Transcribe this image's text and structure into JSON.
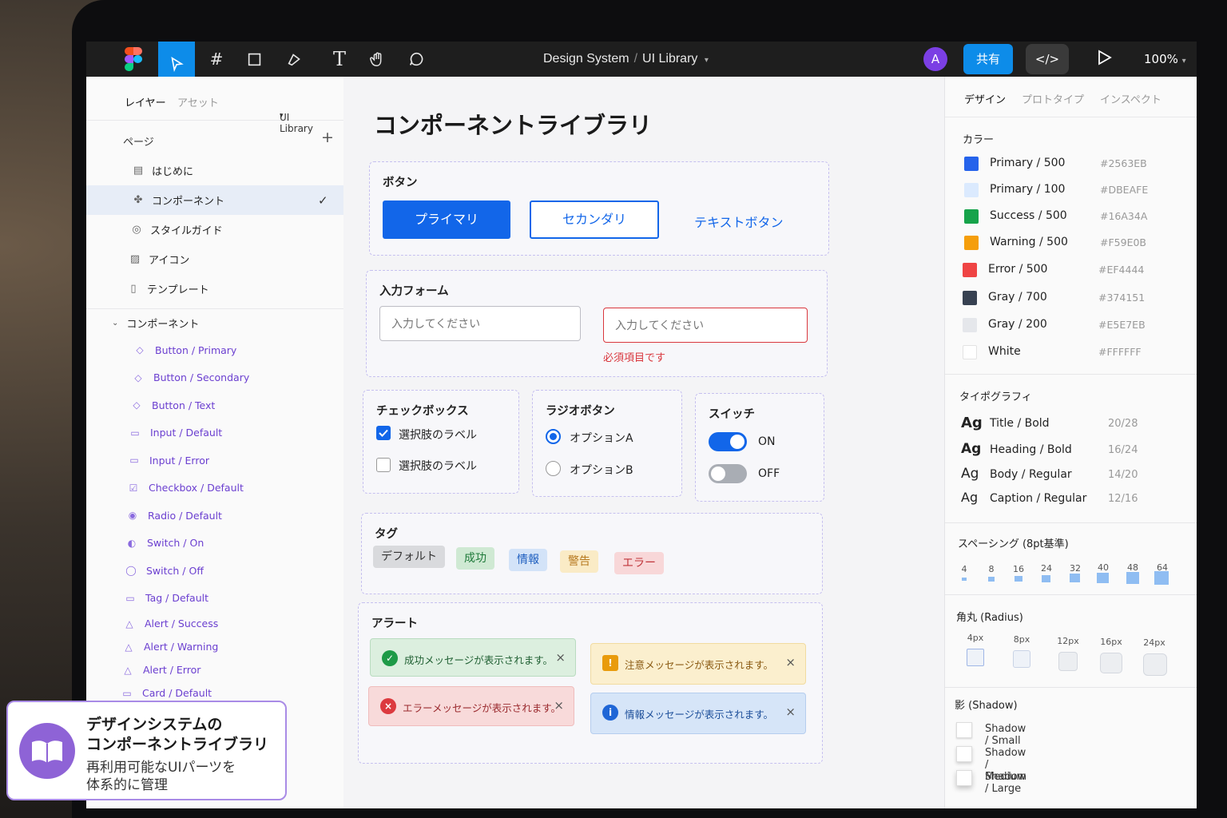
{
  "toolbar": {
    "breadcrumb_root": "Design System",
    "breadcrumb_sep": "/",
    "breadcrumb_current": "UI Library",
    "avatar_initial": "A",
    "share_label": "共有",
    "code_label": "</>",
    "zoom": "100%"
  },
  "left_panel": {
    "tab_layers": "レイヤー",
    "tab_assets": "アセット",
    "file_name": "UI Library",
    "pages_header": "ページ",
    "add_symbol": "+",
    "pages": [
      {
        "label": "はじめに"
      },
      {
        "label": "コンポーネント"
      },
      {
        "label": "スタイルガイド"
      },
      {
        "label": "アイコン"
      },
      {
        "label": "テンプレート"
      }
    ],
    "components_header": "コンポーネント",
    "components": [
      {
        "label": "Button / Primary"
      },
      {
        "label": "Button / Secondary"
      },
      {
        "label": "Button / Text"
      },
      {
        "label": "Input / Default"
      },
      {
        "label": "Input / Error"
      },
      {
        "label": "Checkbox / Default"
      },
      {
        "label": "Radio / Default"
      },
      {
        "label": "Switch / On"
      },
      {
        "label": "Switch / Off"
      },
      {
        "label": "Tag / Default"
      },
      {
        "label": "Alert / Success"
      },
      {
        "label": "Alert / Warning"
      },
      {
        "label": "Alert / Error"
      },
      {
        "label": "Card / Default"
      }
    ]
  },
  "canvas": {
    "page_title": "コンポーネントライブラリ",
    "buttons": {
      "label": "ボタン",
      "primary": "プライマリ",
      "secondary": "セカンダリ",
      "text": "テキストボタン"
    },
    "form": {
      "label": "入力フォーム",
      "placeholder": "入力してください",
      "error_placeholder": "入力してください",
      "error_message": "必須項目です"
    },
    "checkbox": {
      "label": "チェックボックス",
      "option1": "選択肢のラベル",
      "option1_checked": true,
      "option2": "選択肢のラベル",
      "option2_checked": false
    },
    "radio": {
      "label": "ラジオボタン",
      "optionA": "オプションA",
      "optionB": "オプションB",
      "selected": "A"
    },
    "switch": {
      "label": "スイッチ",
      "on_label": "ON",
      "off_label": "OFF"
    },
    "tags": {
      "label": "タグ",
      "items": [
        "デフォルト",
        "成功",
        "情報",
        "警告",
        "エラー"
      ]
    },
    "alerts": {
      "label": "アラート",
      "success": "成功メッセージが表示されます。",
      "warning": "注意メッセージが表示されます。",
      "error": "エラーメッセージが表示されます。",
      "info": "情報メッセージが表示されます。",
      "close": "×"
    }
  },
  "right_panel": {
    "tab_design": "デザイン",
    "tab_prototype": "プロトタイプ",
    "tab_inspect": "インスペクト",
    "colors_header": "カラー",
    "colors": [
      {
        "name": "Primary / 500",
        "hex": "#2563EB"
      },
      {
        "name": "Primary / 100",
        "hex": "#DBEAFE"
      },
      {
        "name": "Success / 500",
        "hex": "#16A34A"
      },
      {
        "name": "Warning / 500",
        "hex": "#F59E0B"
      },
      {
        "name": "Error / 500",
        "hex": "#EF4444"
      },
      {
        "name": "Gray / 700",
        "hex": "#374151"
      },
      {
        "name": "Gray / 200",
        "hex": "#E5E7EB"
      },
      {
        "name": "White",
        "hex": "#FFFFFF"
      }
    ],
    "typography_header": "タイポグラフィ",
    "typography": [
      {
        "sample": "Ag",
        "name": "Title / Bold",
        "size": "20/28"
      },
      {
        "sample": "Ag",
        "name": "Heading / Bold",
        "size": "16/24"
      },
      {
        "sample": "Ag",
        "name": "Body / Regular",
        "size": "14/20"
      },
      {
        "sample": "Ag",
        "name": "Caption / Regular",
        "size": "12/16"
      }
    ],
    "spacing_header": "スペーシング (8pt基準)",
    "spacing": [
      "4",
      "8",
      "16",
      "24",
      "32",
      "40",
      "48",
      "64"
    ],
    "radius_header": "角丸 (Radius)",
    "radius": [
      "4px",
      "8px",
      "12px",
      "16px",
      "24px"
    ],
    "shadow_header": "影 (Shadow)",
    "shadows": [
      "Shadow / Small",
      "Shadow / Medium",
      "Shadow / Large"
    ]
  },
  "overlay": {
    "title_line1": "デザインシステムの",
    "title_line2": "コンポーネントライブラリ",
    "subtitle_line1": "再利用可能なUIパーツを",
    "subtitle_line2": "体系的に管理"
  },
  "colors_ui": {
    "accent": "#1266E9",
    "toolbar_bg": "#1E1E1E",
    "purple": "#7B3FE4"
  }
}
